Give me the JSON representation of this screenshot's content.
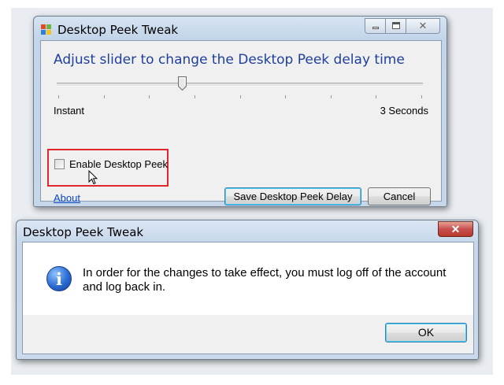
{
  "main_window": {
    "title": "Desktop Peek Tweak",
    "heading": "Adjust slider to change the Desktop Peek delay time",
    "slider": {
      "min_label": "Instant",
      "max_label": "3 Seconds",
      "value_fraction": 0.34,
      "tick_count": 9
    },
    "checkbox": {
      "label": "Enable Desktop Peek",
      "checked": false
    },
    "about_link": "About",
    "save_button": "Save Desktop Peek Delay",
    "cancel_button": "Cancel",
    "close_glyph": "✕",
    "highlight_color": "#e2262b"
  },
  "message_box": {
    "title": "Desktop Peek Tweak",
    "close_glyph": "✕",
    "icon": "info-icon",
    "icon_glyph": "i",
    "message": "In order for the changes to take effect, you must log off of the account and log back in.",
    "ok_button": "OK"
  },
  "colors": {
    "heading": "#1e3f9a",
    "link": "#0645c8",
    "close_button": "#c75050"
  }
}
